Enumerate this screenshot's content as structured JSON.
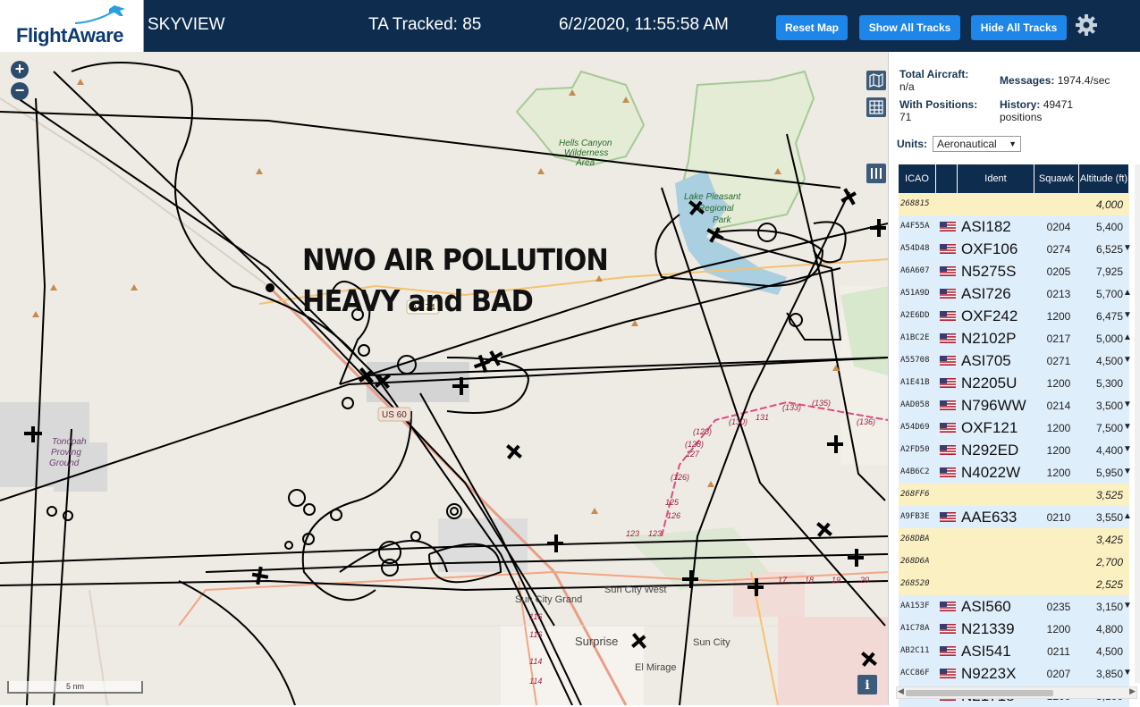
{
  "header": {
    "logo_text": "FlightAware",
    "app_name": "SKYVIEW",
    "tracked": "TA Tracked: 85",
    "datetime": "6/2/2020, 11:55:58 AM",
    "buttons": {
      "reset": "Reset Map",
      "show_all": "Show All Tracks",
      "hide_all": "Hide All Tracks"
    },
    "brand_color": "#0d2c4e",
    "button_color": "#1e86e8"
  },
  "map": {
    "overlay_line1": "NWO AIR POLLUTION",
    "overlay_line2": "HEAVY and BAD",
    "scale_label": "5 nm",
    "labels": {
      "hells_canyon": "Hells Canyon",
      "wilderness": "Wilderness",
      "area": "Area",
      "lake_pleasant": "Lake Pleasant",
      "regional": "Regional",
      "park": "Park",
      "az74": "AZ 74",
      "us60": "US 60",
      "tonopah1": "Tonopah",
      "tonopah2": "Proving",
      "tonopah3": "Ground",
      "sun_city_grand": "Sun City Grand",
      "sun_city_west": "Sun City West",
      "surprise": "Surprise",
      "sun_city": "Sun City",
      "el_mirage": "El Mirage"
    },
    "road_numbers": [
      "(128)",
      "127",
      "(126)",
      "125",
      "126",
      "123",
      "(130)",
      "131",
      "(133)",
      "(135)",
      "(136)",
      "116",
      "116",
      "114",
      "114",
      "(128)",
      "123",
      "17",
      "18",
      "19",
      "20"
    ]
  },
  "stats": {
    "total_aircraft_label": "Total Aircraft:",
    "total_aircraft_value": "n/a",
    "messages_label": "Messages:",
    "messages_value": "1974.4/sec",
    "with_positions_label": "With Positions:",
    "with_positions_value": "71",
    "history_label": "History:",
    "history_value": "49471",
    "history_unit": "positions"
  },
  "units": {
    "label": "Units:",
    "selected": "Aeronautical"
  },
  "table": {
    "headers": {
      "icao": "ICAO",
      "flag": "",
      "ident": "Ident",
      "squawk": "Squawk",
      "altitude": "Altitude (ft)"
    },
    "rows": [
      {
        "icao": "268815",
        "ident": "",
        "squawk": "",
        "alt": "4,000",
        "arrow": "",
        "flag": false,
        "style": "sel"
      },
      {
        "icao": "A4F55A",
        "ident": "ASI182",
        "squawk": "0204",
        "alt": "5,400",
        "arrow": "",
        "flag": true,
        "style": "reg"
      },
      {
        "icao": "A54D48",
        "ident": "OXF106",
        "squawk": "0274",
        "alt": "6,525",
        "arrow": "▼",
        "flag": true,
        "style": "reg"
      },
      {
        "icao": "A6A607",
        "ident": "N5275S",
        "squawk": "0205",
        "alt": "7,925",
        "arrow": "",
        "flag": true,
        "style": "reg"
      },
      {
        "icao": "A51A9D",
        "ident": "ASI726",
        "squawk": "0213",
        "alt": "5,700",
        "arrow": "▲",
        "flag": true,
        "style": "reg"
      },
      {
        "icao": "A2E6DD",
        "ident": "OXF242",
        "squawk": "1200",
        "alt": "6,475",
        "arrow": "▼",
        "flag": true,
        "style": "reg"
      },
      {
        "icao": "A1BC2E",
        "ident": "N2102P",
        "squawk": "0217",
        "alt": "5,000",
        "arrow": "▲",
        "flag": true,
        "style": "reg"
      },
      {
        "icao": "A55708",
        "ident": "ASI705",
        "squawk": "0271",
        "alt": "4,500",
        "arrow": "▼",
        "flag": true,
        "style": "reg"
      },
      {
        "icao": "A1E41B",
        "ident": "N2205U",
        "squawk": "1200",
        "alt": "5,300",
        "arrow": "",
        "flag": true,
        "style": "reg"
      },
      {
        "icao": "AAD058",
        "ident": "N796WW",
        "squawk": "0214",
        "alt": "3,500",
        "arrow": "▼",
        "flag": true,
        "style": "reg"
      },
      {
        "icao": "A54D69",
        "ident": "OXF121",
        "squawk": "1200",
        "alt": "7,500",
        "arrow": "▼",
        "flag": true,
        "style": "reg"
      },
      {
        "icao": "A2FD50",
        "ident": "N292ED",
        "squawk": "1200",
        "alt": "4,400",
        "arrow": "▼",
        "flag": true,
        "style": "reg"
      },
      {
        "icao": "A4B6C2",
        "ident": "N4022W",
        "squawk": "1200",
        "alt": "5,950",
        "arrow": "▼",
        "flag": true,
        "style": "reg"
      },
      {
        "icao": "268FF6",
        "ident": "",
        "squawk": "",
        "alt": "3,525",
        "arrow": "",
        "flag": false,
        "style": "sel"
      },
      {
        "icao": "A9FB3E",
        "ident": "AAE633",
        "squawk": "0210",
        "alt": "3,550",
        "arrow": "▲",
        "flag": true,
        "style": "reg"
      },
      {
        "icao": "268DBA",
        "ident": "",
        "squawk": "",
        "alt": "3,425",
        "arrow": "",
        "flag": false,
        "style": "sel"
      },
      {
        "icao": "268D6A",
        "ident": "",
        "squawk": "",
        "alt": "2,700",
        "arrow": "",
        "flag": false,
        "style": "sel"
      },
      {
        "icao": "268520",
        "ident": "",
        "squawk": "",
        "alt": "2,525",
        "arrow": "",
        "flag": false,
        "style": "sel"
      },
      {
        "icao": "AA153F",
        "ident": "ASI560",
        "squawk": "0235",
        "alt": "3,150",
        "arrow": "▼",
        "flag": true,
        "style": "reg"
      },
      {
        "icao": "A1C78A",
        "ident": "N21339",
        "squawk": "1200",
        "alt": "4,800",
        "arrow": "",
        "flag": true,
        "style": "reg"
      },
      {
        "icao": "AB2C11",
        "ident": "ASI541",
        "squawk": "0211",
        "alt": "4,500",
        "arrow": "",
        "flag": true,
        "style": "reg"
      },
      {
        "icao": "ACC86F",
        "ident": "N9223X",
        "squawk": "0207",
        "alt": "3,850",
        "arrow": "▼",
        "flag": true,
        "style": "reg"
      },
      {
        "icao": "A1D61F",
        "ident": "N21718",
        "squawk": "1200",
        "alt": "5,100",
        "arrow": "▼",
        "flag": true,
        "style": "reg"
      }
    ]
  },
  "icons": {
    "gear": "gear-icon",
    "zoom_in": "plus-icon",
    "zoom_out": "minus-icon",
    "map_layers": "map-icon",
    "grid": "grid-icon",
    "columns": "columns-icon",
    "info": "info-icon"
  }
}
